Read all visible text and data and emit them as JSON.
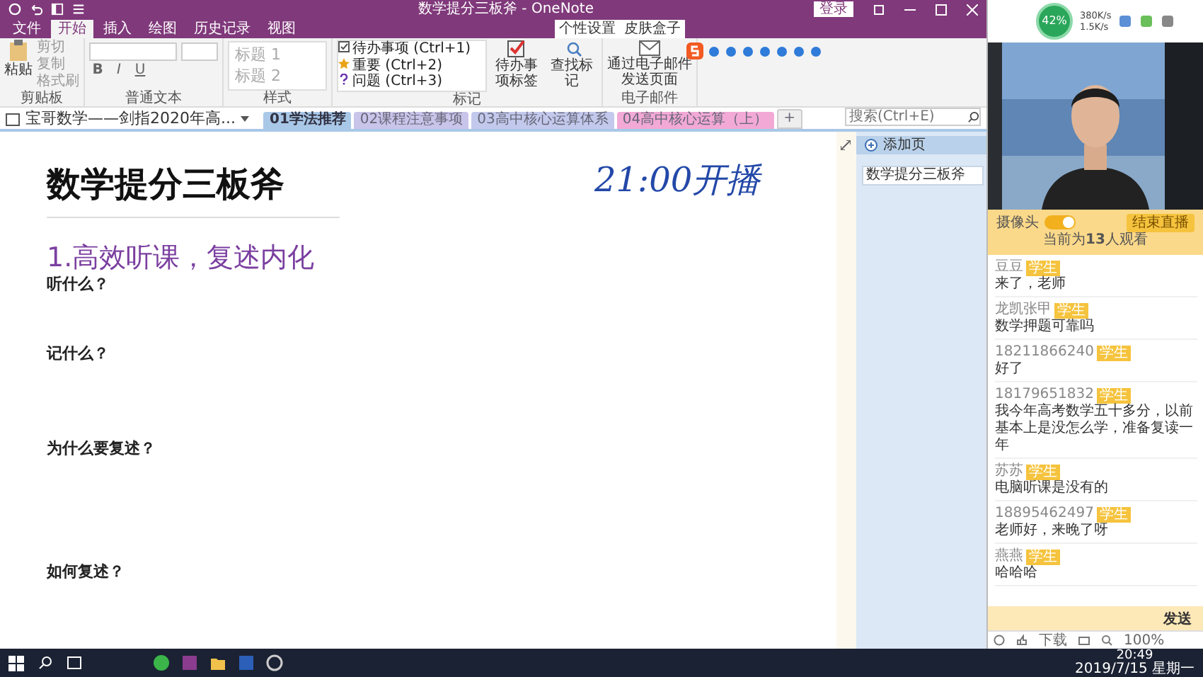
{
  "window": {
    "title": "数学提分三板斧 - OneNote",
    "login": "登录"
  },
  "menu_tabs": [
    {
      "label": "文件",
      "selected": false
    },
    {
      "label": "开始",
      "selected": true
    },
    {
      "label": "插入",
      "selected": false
    },
    {
      "label": "绘图",
      "selected": false
    },
    {
      "label": "历史记录",
      "selected": false
    },
    {
      "label": "视图",
      "selected": false
    }
  ],
  "ime_bar": {
    "tabs": [
      "个性设置",
      "皮肤盒子"
    ]
  },
  "ribbon": {
    "clipboard": {
      "paste": "粘贴",
      "items": [
        "剪切",
        "复制",
        "格式刷"
      ],
      "label": "剪贴板"
    },
    "text": {
      "format_buttons": [
        "B",
        "I",
        "U"
      ],
      "label": "普通文本"
    },
    "styles": {
      "items": [
        "标题 1",
        "标题 2"
      ],
      "label": "样式"
    },
    "tags": {
      "items": [
        {
          "kind": "check",
          "label": "待办事项 (Ctrl+1)"
        },
        {
          "kind": "star",
          "label": "重要 (Ctrl+2)"
        },
        {
          "kind": "question",
          "label": "问题 (Ctrl+3)"
        }
      ],
      "label": "标记"
    },
    "todo_tag": "待办事项标签",
    "find_tags": "查找标记",
    "email": {
      "button": "通过电子邮件发送页面",
      "label": "电子邮件"
    }
  },
  "notebook": {
    "name": "宝哥数学——剑指2020年高...",
    "sections": [
      {
        "label": "01学法推荐",
        "color": "#a9c8e8",
        "selected": true
      },
      {
        "label": "02课程注意事项",
        "color": "#c9c4ea",
        "selected": false
      },
      {
        "label": "03高中核心运算体系",
        "color": "#c3c9ec",
        "selected": false
      },
      {
        "label": "04高中核心运算（上）",
        "color": "#f2a9d6",
        "selected": false
      }
    ],
    "add_section": "+",
    "search": {
      "placeholder": "搜索(Ctrl+E)"
    }
  },
  "page": {
    "title": "数学提分三板斧",
    "handwriting": "21:00开播",
    "heading": "1.高效听课，复述内化",
    "questions": [
      "听什么？",
      "记什么？",
      "为什么要复述？",
      "如何复述？"
    ]
  },
  "page_list": {
    "add": "添加页",
    "pages": [
      {
        "label": "数学提分三板斧",
        "selected": true
      }
    ]
  },
  "status": {
    "battery": "42%",
    "upload": "380K/s",
    "download": "1.5K/s"
  },
  "live": {
    "camera_label": "摄像头",
    "camera_on": true,
    "end_button": "结束直播",
    "viewers": "当前为**13**人观看"
  },
  "chat": [
    {
      "name": "豆豆",
      "badge": "学生",
      "message": "来了，老师"
    },
    {
      "name": "龙凯张甲",
      "badge": "学生",
      "message": "数学押题可靠吗"
    },
    {
      "name": "18211866240",
      "badge": "学生",
      "message": "好了"
    },
    {
      "name": "18179651832",
      "badge": "学生",
      "message": "我今年高考数学五十多分，以前基本上是没怎么学，准备复读一年"
    },
    {
      "name": "苏苏",
      "badge": "学生",
      "message": "电脑听课是没有的"
    },
    {
      "name": "18895462497",
      "badge": "学生",
      "message": "老师好，来晚了呀"
    },
    {
      "name": "燕燕",
      "badge": "学生",
      "message": "哈哈哈"
    }
  ],
  "send_button": "发送",
  "chat_tools": {
    "download": "下载",
    "zoom": "100%"
  },
  "taskbar": {
    "time": "20:49",
    "date": "2019/7/15 星期一"
  }
}
